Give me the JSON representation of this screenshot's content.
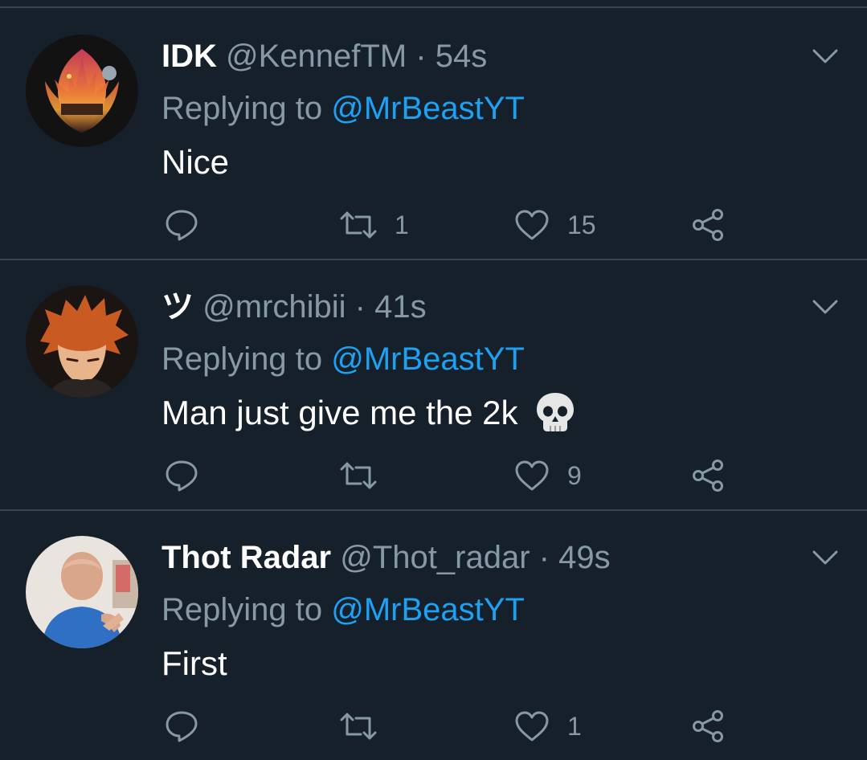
{
  "tweets": [
    {
      "display_name": "IDK",
      "handle": "@KennefTM",
      "separator": "·",
      "time": "54s",
      "replying_prefix": "Replying to",
      "replying_to": "@MrBeastYT",
      "text": "Nice",
      "emoji": "",
      "retweets": "1",
      "likes": "15",
      "avatar_icon": "rebel-alliance-logo"
    },
    {
      "display_name": "ツ",
      "handle": "@mrchibii",
      "separator": "·",
      "time": "41s",
      "replying_prefix": "Replying to",
      "replying_to": "@MrBeastYT",
      "text": "Man just give me the 2k",
      "emoji": "skull-emoji",
      "retweets": "",
      "likes": "9",
      "avatar_icon": "anime-character"
    },
    {
      "display_name": "Thot Radar",
      "handle": "@Thot_radar",
      "separator": "·",
      "time": "49s",
      "replying_prefix": "Replying to",
      "replying_to": "@MrBeastYT",
      "text": "First",
      "emoji": "",
      "retweets": "",
      "likes": "1",
      "avatar_icon": "man-in-blue-shirt"
    }
  ],
  "icons": {
    "reply": "reply-icon",
    "retweet": "retweet-icon",
    "like": "heart-icon",
    "share": "share-icon",
    "caret": "chevron-down-icon"
  },
  "colors": {
    "background": "#15202b",
    "divider": "#38444d",
    "secondary_text": "#8899a6",
    "mention": "#1da1f2"
  }
}
